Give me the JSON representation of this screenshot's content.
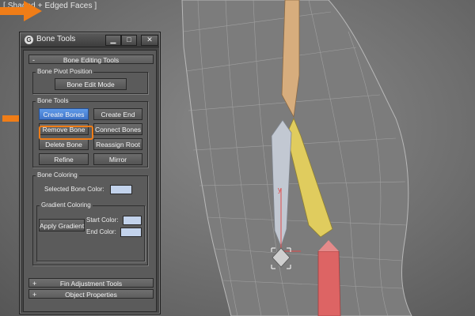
{
  "viewport": {
    "label": "[ Shaded + Edged Faces ]",
    "gizmo_axis_label": "y"
  },
  "window": {
    "title": "Bone Tools",
    "min_symbol": "▁",
    "max_symbol": "□",
    "close_symbol": "✕"
  },
  "rollouts": {
    "bone_editing": {
      "sign": "-",
      "label": "Bone Editing Tools"
    },
    "fin_adjustment": {
      "sign": "+",
      "label": "Fin Adjustment Tools"
    },
    "object_properties": {
      "sign": "+",
      "label": "Object Properties"
    }
  },
  "bone_pivot": {
    "group_label": "Bone Pivot Position",
    "edit_mode_button": "Bone Edit Mode"
  },
  "bone_tools": {
    "group_label": "Bone Tools",
    "create_bones": "Create Bones",
    "create_end": "Create End",
    "remove_bone": "Remove Bone",
    "connect_bones": "Connect Bones",
    "delete_bone": "Delete Bone",
    "reassign_root": "Reassign Root",
    "refine": "Refine",
    "mirror": "Mirror"
  },
  "bone_coloring": {
    "group_label": "Bone Coloring",
    "selected_bone_color_label": "Selected Bone Color:",
    "gradient_group_label": "Gradient Coloring",
    "apply_gradient": "Apply Gradient",
    "start_color_label": "Start Color:",
    "end_color_label": "End Color:",
    "selected_color": "#c3d3ec",
    "start_color": "#c3d3ec",
    "end_color": "#c3d3ec"
  },
  "colors": {
    "accent_orange": "#f07d17",
    "active_button_blue": "#4f88db",
    "bone_tan": "#d7ad7d",
    "bone_yellow": "#e0cc5e",
    "bone_red": "#dd6464",
    "bone_selected": "#c2c8d2"
  }
}
